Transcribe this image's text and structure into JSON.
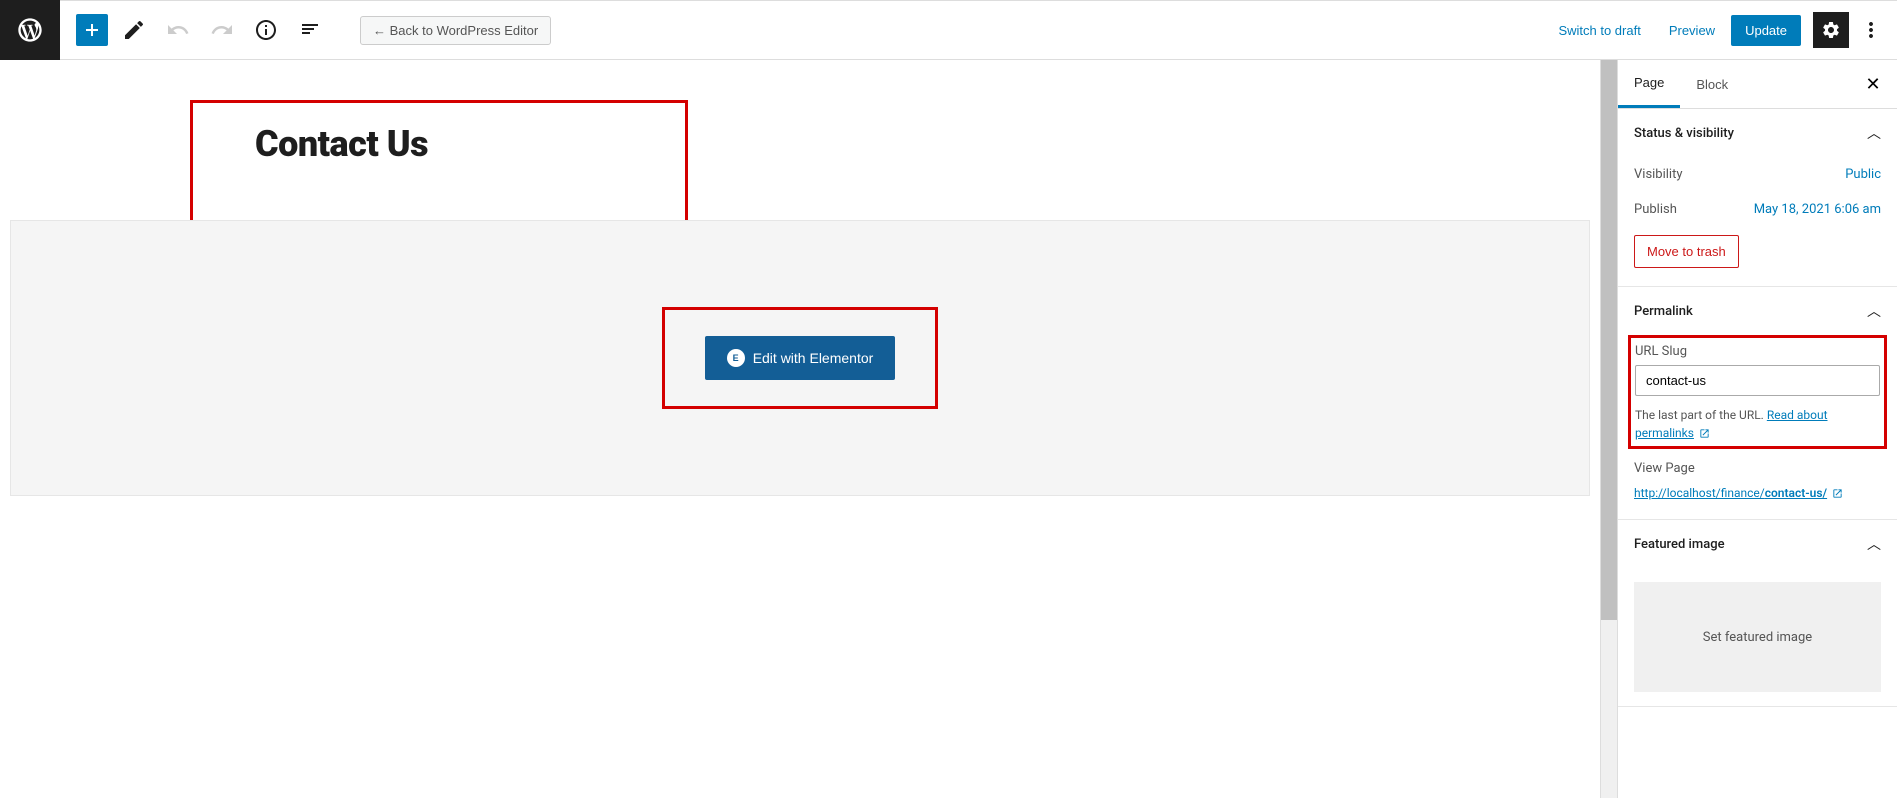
{
  "toolbar": {
    "back_label": "← Back to WordPress Editor",
    "switch_draft": "Switch to draft",
    "preview": "Preview",
    "update": "Update"
  },
  "editor": {
    "title": "Contact Us",
    "elementor_button": "Edit with Elementor"
  },
  "sidebar": {
    "tabs": {
      "page": "Page",
      "block": "Block"
    },
    "status": {
      "header": "Status & visibility",
      "visibility_label": "Visibility",
      "visibility_value": "Public",
      "publish_label": "Publish",
      "publish_value": "May 18, 2021 6:06 am",
      "trash": "Move to trash"
    },
    "permalink": {
      "header": "Permalink",
      "slug_label": "URL Slug",
      "slug_value": "contact-us",
      "help_prefix": "The last part of the URL. ",
      "help_link": "Read about permalinks",
      "view_page": "View Page",
      "url_base": "http://localhost/finance/",
      "url_slug": "contact-us/"
    },
    "featured": {
      "header": "Featured image",
      "placeholder": "Set featured image"
    }
  }
}
